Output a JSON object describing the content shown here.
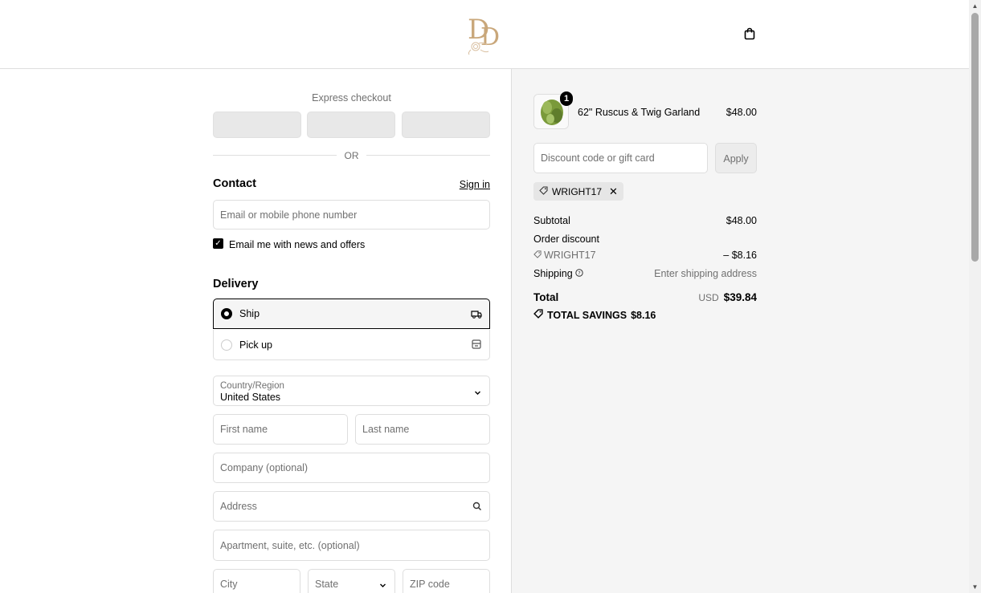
{
  "header": {
    "logo_text": "DD",
    "cart_icon": "shopping-bag-icon"
  },
  "express": {
    "label": "Express checkout",
    "or_text": "OR"
  },
  "contact": {
    "title": "Contact",
    "sign_in": "Sign in",
    "email_placeholder": "Email or mobile phone number",
    "newsletter_label": "Email me with news and offers",
    "newsletter_checked": true
  },
  "delivery": {
    "title": "Delivery",
    "options": [
      {
        "label": "Ship",
        "selected": true,
        "icon": "truck-icon"
      },
      {
        "label": "Pick up",
        "selected": false,
        "icon": "store-icon"
      }
    ],
    "country_label": "Country/Region",
    "country_value": "United States",
    "first_name": "First name",
    "last_name": "Last name",
    "company": "Company (optional)",
    "address": "Address",
    "apartment": "Apartment, suite, etc. (optional)",
    "city": "City",
    "state": "State",
    "zip": "ZIP code"
  },
  "summary": {
    "item": {
      "name": "62\" Ruscus & Twig Garland",
      "price": "$48.00",
      "quantity": "1"
    },
    "discount_placeholder": "Discount code or gift card",
    "apply_label": "Apply",
    "applied_code": "WRIGHT17",
    "subtotal_label": "Subtotal",
    "subtotal_value": "$48.00",
    "order_discount_label": "Order discount",
    "discount_code": "WRIGHT17",
    "discount_value": "– $8.16",
    "shipping_label": "Shipping",
    "shipping_value": "Enter shipping address",
    "total_label": "Total",
    "currency": "USD",
    "total_value": "$39.84",
    "savings_label": "TOTAL SAVINGS",
    "savings_value": "$8.16"
  },
  "colors": {
    "accent": "#000000",
    "summary_bg": "#f5f5f5",
    "muted_text": "#707070",
    "border": "#dedede",
    "logo_gold": "#c9a77a"
  }
}
